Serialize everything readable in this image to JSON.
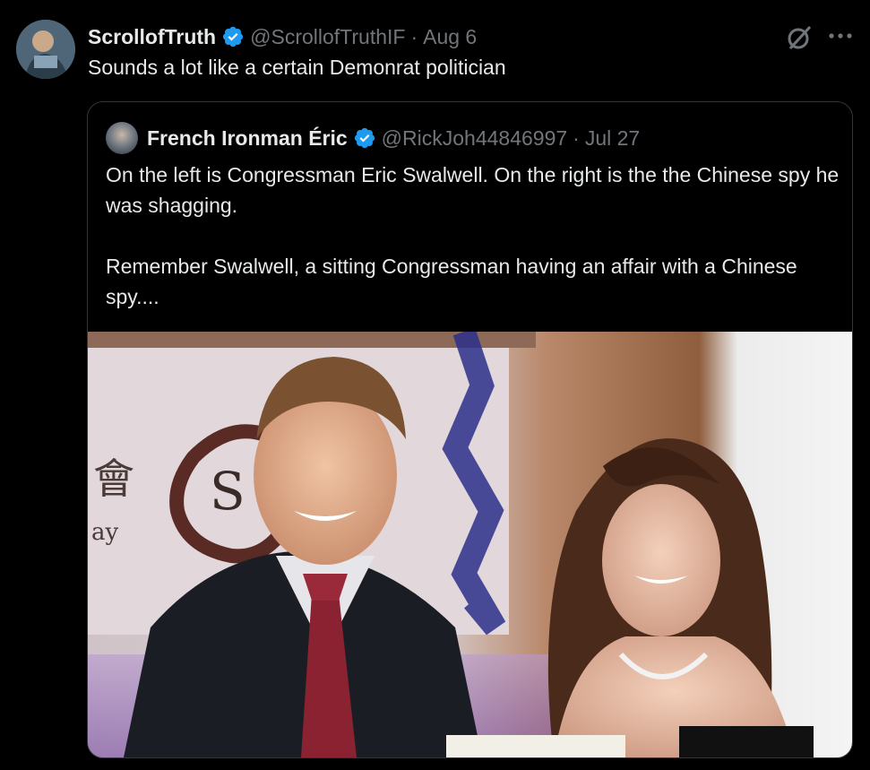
{
  "tweet": {
    "display_name": "ScrollofTruth",
    "handle": "@ScrollofTruthIF",
    "separator": "·",
    "date": "Aug 6",
    "text": "Sounds a lot like a certain Demonrat politician"
  },
  "quoted_tweet": {
    "display_name": "French Ironman Éric",
    "handle": "@RickJoh44846997",
    "separator": "·",
    "date": "Jul 27",
    "paragraphs": [
      "On the left is Congressman Eric Swalwell. On the right is the the Chinese spy he was shagging.",
      "Remember Swalwell, a sitting Congressman having an affair with a Chinese spy...."
    ]
  },
  "photo_text": {
    "char": "會",
    "fragment": "ay",
    "logo_letter": "S"
  },
  "icons": {
    "verified": "verified-badge-icon",
    "grok": "grok-icon",
    "more": "more-icon"
  },
  "colors": {
    "background": "#000000",
    "text": "#e7e9ea",
    "muted": "#71767b",
    "verified": "#1d9bf0",
    "border": "#333639"
  }
}
